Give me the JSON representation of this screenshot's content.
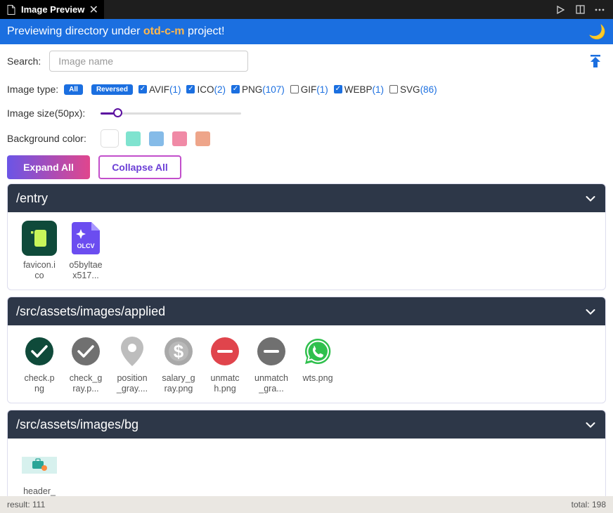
{
  "tab": {
    "title": "Image Preview",
    "close": "✕"
  },
  "banner": {
    "prefix": "Previewing directory under ",
    "project": "otd-c-m",
    "suffix": " project!"
  },
  "search": {
    "label": "Search:",
    "placeholder": "Image name"
  },
  "image_type": {
    "label": "Image type:",
    "all_label": "All",
    "reversed_label": "Reversed",
    "types": [
      {
        "name": "AVIF",
        "count": "(1)",
        "checked": true
      },
      {
        "name": "ICO",
        "count": "(2)",
        "checked": true
      },
      {
        "name": "PNG",
        "count": "(107)",
        "checked": true
      },
      {
        "name": "GIF",
        "count": "(1)",
        "checked": false
      },
      {
        "name": "WEBP",
        "count": "(1)",
        "checked": true
      },
      {
        "name": "SVG",
        "count": "(86)",
        "checked": false
      }
    ]
  },
  "image_size": {
    "label": "Image size(50px):",
    "value_fraction": 0.12
  },
  "background": {
    "label": "Background color:",
    "colors": [
      "#ffffff",
      "#7fe3cf",
      "#85bbe8",
      "#f08aa6",
      "#eea58a"
    ]
  },
  "buttons": {
    "expand": "Expand All",
    "collapse": "Collapse All"
  },
  "sections": [
    {
      "path": "/entry",
      "items": [
        {
          "name": "favicon.ico",
          "icon": "favicon-icon"
        },
        {
          "name": "o5byltaex517...",
          "icon": "olcv-file-icon"
        }
      ]
    },
    {
      "path": "/src/assets/images/applied",
      "items": [
        {
          "name": "check.png",
          "icon": "check-dark-icon"
        },
        {
          "name": "check_gray.p...",
          "icon": "check-gray-icon"
        },
        {
          "name": "position_gray....",
          "icon": "location-pin-icon"
        },
        {
          "name": "salary_gray.png",
          "icon": "dollar-icon"
        },
        {
          "name": "unmatch.png",
          "icon": "minus-red-icon"
        },
        {
          "name": "unmatch_gra...",
          "icon": "minus-gray-icon"
        },
        {
          "name": "wts.png",
          "icon": "whatsapp-icon"
        }
      ]
    },
    {
      "path": "/src/assets/images/bg",
      "items": [
        {
          "name": "header_",
          "icon": "header-bg-thumbnail"
        }
      ]
    }
  ],
  "status": {
    "result": "result: 111",
    "total": "total: 198"
  }
}
